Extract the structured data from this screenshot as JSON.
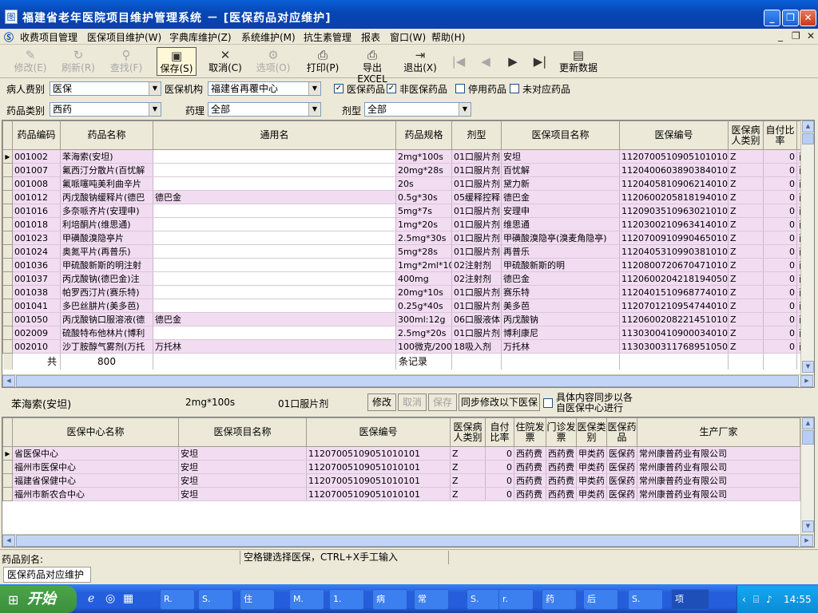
{
  "window": {
    "title": "福建省老年医院项目维护管理系统 － [医保药品对应维护]"
  },
  "menu": [
    "收费项目管理",
    "医保项目维护(W)",
    "字典库维护(Z)",
    "系统维护(M)",
    "抗生素管理",
    "报表",
    "窗口(W)",
    "帮助(H)"
  ],
  "toolbar": {
    "modify": "修改(E)",
    "refresh": "刷新(R)",
    "find": "查找(F)",
    "save": "保存(S)",
    "cancel": "取消(C)",
    "options": "选项(O)",
    "print": "打印(P)",
    "export": "导出EXCEL",
    "exit": "退出(X)",
    "update": "更新数据"
  },
  "filters": {
    "patient_fee_label": "病人费别",
    "patient_fee": "医保",
    "org_label": "医保机构",
    "org": "福建省再覆中心",
    "chk_insured": "医保药品",
    "chk_noninsured": "非医保药品",
    "chk_disabled": "停用药品",
    "chk_unmatched": "未对应药品",
    "drug_type_label": "药品类别",
    "drug_type": "西药",
    "pharm_label": "药理",
    "pharm": "全部",
    "form_label": "剂型",
    "form": "全部"
  },
  "grid1": {
    "headers": [
      "药品编码",
      "药品名称",
      "通用名",
      "药品规格",
      "剂型",
      "医保项目名称",
      "医保编号",
      "医保病人类别",
      "自付比率",
      ""
    ],
    "rows": [
      [
        "001002",
        "苯海索(安坦)",
        "",
        "2mg*100s",
        "01口服片剂",
        "安坦",
        "11207005109051010101",
        "Z",
        "0",
        "西"
      ],
      [
        "001007",
        "氟西汀分散片(百忧解",
        "",
        "20mg*28s",
        "01口服片剂",
        "百忧解",
        "11204006038903840101",
        "Z",
        "0",
        "西"
      ],
      [
        "001008",
        "氟哌噻吨美利曲辛片",
        "",
        "20s",
        "01口服片剂",
        "黛力新",
        "11204058109062140101",
        "Z",
        "0",
        "西"
      ],
      [
        "001012",
        "丙戊酸钠缓释片(德巴",
        "德巴金",
        "0.5g*30s",
        "05缓释控释",
        "德巴金",
        "11206002058181940101",
        "Z",
        "0",
        "西"
      ],
      [
        "001016",
        "多奈哌齐片(安理申)",
        "",
        "5mg*7s",
        "01口服片剂",
        "安理申",
        "11209035109630210101",
        "Z",
        "0",
        "西"
      ],
      [
        "001018",
        "利培酮片(维思通)",
        "",
        "1mg*20s",
        "01口服片剂",
        "维思通",
        "11203002109634140101",
        "Z",
        "0",
        "西"
      ],
      [
        "001023",
        "甲磺酸溴隐亭片",
        "",
        "2.5mg*30s",
        "01口服片剂",
        "甲磺酸溴隐亭(溴麦角隐亭)",
        "11207009109904650101",
        "Z",
        "0",
        "西"
      ],
      [
        "001024",
        "奥氮平片(再普乐)",
        "",
        "5mg*28s",
        "01口服片剂",
        "再普乐",
        "11204053109903810101",
        "Z",
        "0",
        "西"
      ],
      [
        "001036",
        "甲硫酸新斯的明注射",
        "",
        "1mg*2ml*10",
        "02注射剂",
        "甲硫酸新斯的明",
        "11208007206704710102",
        "Z",
        "0",
        "西"
      ],
      [
        "001037",
        "丙戊酸钠(德巴金)注",
        "",
        "400mg",
        "02注射剂",
        "德巴金",
        "11206002042181940501",
        "Z",
        "0",
        "西"
      ],
      [
        "001038",
        "帕罗西汀片(赛乐特)",
        "",
        "20mg*10s",
        "01口服片剂",
        "赛乐特",
        "11204015109687740101",
        "Z",
        "0",
        "西"
      ],
      [
        "001041",
        "多巴丝肼片(美多芭)",
        "",
        "0.25g*40s",
        "01口服片剂",
        "美多芭",
        "11207012109547440102",
        "Z",
        "0",
        "西"
      ],
      [
        "001050",
        "丙戊酸钠口服溶液(德",
        "德巴金",
        "300ml:12g",
        "06口服液体",
        "丙戊酸钠",
        "11206002082214510101",
        "Z",
        "0",
        "西"
      ],
      [
        "002009",
        "硫酸特布他林片(博利",
        "",
        "2.5mg*20s",
        "01口服片剂",
        "博利康尼",
        "11303004109000340101",
        "Z",
        "0",
        "西"
      ],
      [
        "002010",
        "沙丁胺醇气雾剂(万托",
        "万托林",
        "100微克/200",
        "18吸入剂",
        "万托林",
        "11303003117689510501",
        "Z",
        "0",
        "西"
      ]
    ],
    "summary": {
      "total_label": "共",
      "count": "800",
      "records_label": "条记录"
    }
  },
  "detail": {
    "name": "苯海索(安坦)",
    "spec": "2mg*100s",
    "form": "01口服片剂",
    "btn_modify": "修改",
    "btn_cancel": "取消",
    "btn_save": "保存",
    "btn_sync": "同步修改以下医保",
    "sync_note_1": "具体内容同步以各",
    "sync_note_2": "自医保中心进行"
  },
  "grid2": {
    "headers": [
      "医保中心名称",
      "医保项目名称",
      "医保编号",
      "医保病人类别",
      "自付比率",
      "住院发票",
      "门诊发票",
      "医保类别",
      "医保药品",
      "生产厂家"
    ],
    "rows": [
      [
        "省医保中心",
        "安坦",
        "11207005109051010101",
        "Z",
        "0",
        "西药费",
        "西药费",
        "甲类药",
        "医保药",
        "常州康普药业有限公司"
      ],
      [
        "福州市医保中心",
        "安坦",
        "11207005109051010101",
        "Z",
        "0",
        "西药费",
        "西药费",
        "甲类药",
        "医保药",
        "常州康普药业有限公司"
      ],
      [
        "福建省保健中心",
        "安坦",
        "11207005109051010101",
        "Z",
        "0",
        "西药费",
        "西药费",
        "甲类药",
        "医保药",
        "常州康普药业有限公司"
      ],
      [
        "福州市新农合中心",
        "安坦",
        "11207005109051010101",
        "Z",
        "0",
        "西药费",
        "西药费",
        "甲类药",
        "医保药",
        "常州康普药业有限公司"
      ]
    ]
  },
  "status": {
    "alias_label": "药品别名:",
    "hint": "空格键选择医保，CTRL+X手工输入"
  },
  "mdi_tab": "医保药品对应维护",
  "taskbar": {
    "start": "开始",
    "items": [
      "R.",
      "S.",
      "住",
      "M.",
      "1.",
      "病",
      "常",
      "S.",
      "r.",
      "药",
      "后",
      "S.",
      "项"
    ],
    "clock": "14:55"
  }
}
